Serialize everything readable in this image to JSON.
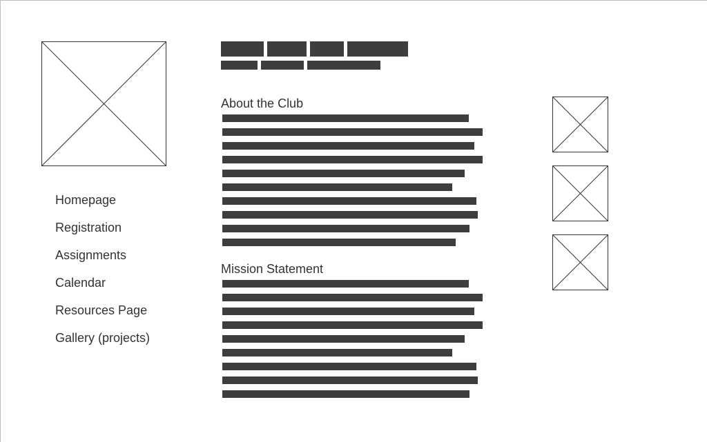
{
  "logo_placeholder": {
    "icon": "image-placeholder-icon"
  },
  "nav": {
    "items": [
      {
        "label": "Homepage"
      },
      {
        "label": "Registration"
      },
      {
        "label": "Assignments"
      },
      {
        "label": "Calendar"
      },
      {
        "label": "Resources Page"
      },
      {
        "label": "Gallery (projects)"
      }
    ]
  },
  "header": {
    "title_word_count": 4,
    "subtitle_word_count": 3
  },
  "sections": [
    {
      "heading": "About the Club",
      "line_count": 10
    },
    {
      "heading": "Mission Statement",
      "line_count": 9
    }
  ],
  "side_images": [
    {
      "icon": "image-placeholder-icon"
    },
    {
      "icon": "image-placeholder-icon"
    },
    {
      "icon": "image-placeholder-icon"
    }
  ],
  "colors": {
    "text": "#333333",
    "blocks": "#3d3d3d",
    "placeholder_stroke": "#333333",
    "background": "#ffffff"
  }
}
